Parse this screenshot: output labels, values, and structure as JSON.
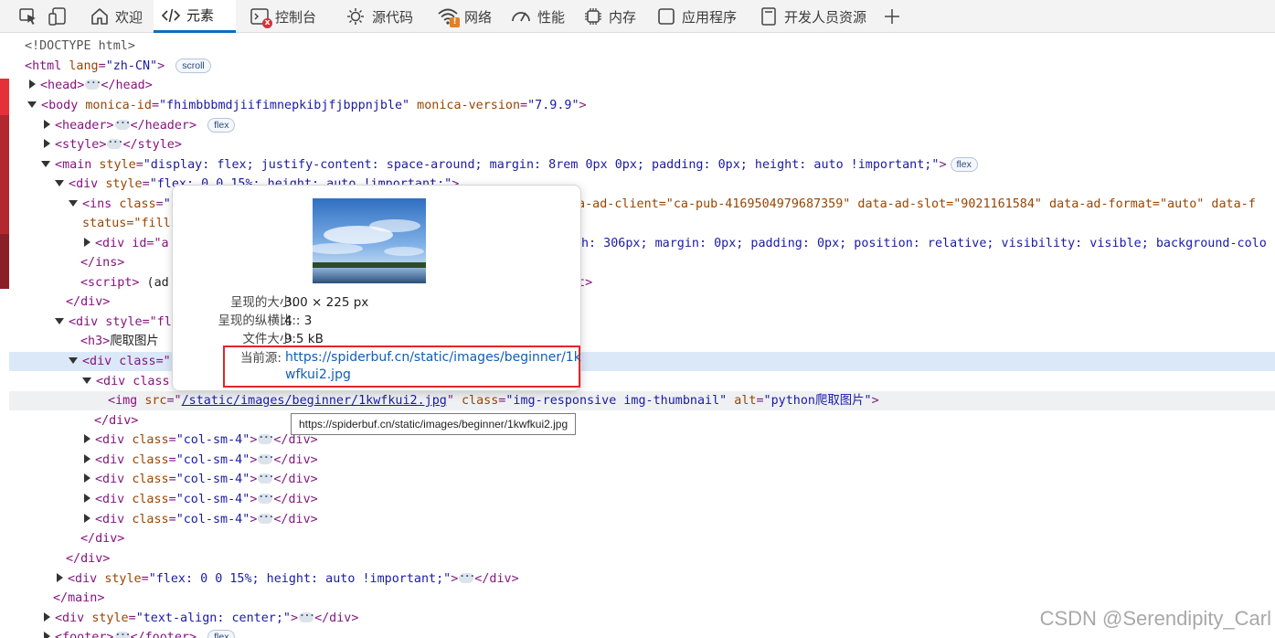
{
  "tabs": [
    {
      "label": "欢迎",
      "icon": "home-icon"
    },
    {
      "label": "元素",
      "icon": "code-brackets-icon",
      "active": true
    },
    {
      "label": "控制台",
      "icon": "console-icon"
    },
    {
      "label": "源代码",
      "icon": "bug-gear-icon"
    },
    {
      "label": "网络",
      "icon": "wifi-icon"
    },
    {
      "label": "性能",
      "icon": "speedometer-icon"
    },
    {
      "label": "内存",
      "icon": "chip-icon"
    },
    {
      "label": "应用程序",
      "icon": "app-window-icon"
    },
    {
      "label": "开发人员资源",
      "icon": "document-icon"
    }
  ],
  "toolbar": {
    "inspect_icon": "inspect-icon",
    "device_icon": "device-emulation-icon",
    "add_tab_icon": "plus-icon"
  },
  "badges": {
    "console": "x",
    "network": "!"
  },
  "tree": {
    "doctype": "<!DOCTYPE html>",
    "html_tag": "html",
    "html_attr": "lang",
    "html_val": "\"zh-CN\"",
    "scroll_pill": "scroll",
    "head_open": "<head>",
    "head_close": "</head>",
    "body_tag": "body",
    "body_attr1": "monica-id",
    "body_val1": "\"fhimbbbmdjiifimnepkibjfjbppnjble\"",
    "body_attr2": "monica-version",
    "body_val2": "\"7.9.9\"",
    "header_open": "<header>",
    "header_close": "</header>",
    "flex_pill": "flex",
    "style_open": "<style>",
    "style_close": "</style>",
    "main_tag": "main",
    "main_attr": "style",
    "main_val": "\"display: flex; justify-content: space-around; margin: 8rem 0px 0px; padding: 0px; height: auto !important;\"",
    "div1_tag": "div",
    "div1_attr": "style",
    "div1_val": "\"flex: 0 0 15%; height: auto !important;\"",
    "ins_tag": "ins",
    "ins_attr": "class",
    "ins_val": "\"",
    "ins_rest": "ta-ad-client=\"ca-pub-4169504979687359\" data-ad-slot=\"9021161584\" data-ad-format=\"auto\" data-f",
    "ins_status": "status=\"fill",
    "divid_open": "<div id=\"a",
    "divid_rest": "h: 306px; margin: 0px; padding: 0px; position: relative; visibility: visible; background-colo",
    "ins_close": "</ins>",
    "script_open": "<script>",
    "script_ad": " (ad",
    "script_rest": "pt>",
    "div_close": "</div>",
    "div2_open": "<div style=\"fl",
    "h3_open": "<h3>",
    "h3_text": "爬取图片",
    "div3_open": "<div class=\"",
    "div4_open": "<div class",
    "img_tag": "img",
    "img_src_attr": "src",
    "img_src": "/static/images/beginner/1kwfkui2.jpg",
    "img_class_attr": "class",
    "img_class": "\"img-responsive img-thumbnail\"",
    "img_alt_attr": "alt",
    "img_alt": "\"python爬取图片\"",
    "colsm": "\"col-sm-4\"",
    "main_close": "</main>",
    "div_last_val": "\"flex: 0 0 15%; height: auto !important;\"",
    "div_center_val": "\"text-align: center;\"",
    "footer_open": "<footer>",
    "footer_close": "</footer>"
  },
  "card": {
    "size_label": "呈现的大小:",
    "size_value": "300 × 225 px",
    "aspect_label": "呈现的纵横比:",
    "aspect_value": "4 : 3",
    "file_label": "文件大小:",
    "file_value": "9.5 kB",
    "source_label": "当前源:",
    "source_value": "https://spiderbuf.cn/static/images/beginner/1kwfkui2.jpg"
  },
  "tooltip": "https://spiderbuf.cn/static/images/beginner/1kwfkui2.jpg",
  "watermark": "CSDN @Serendipity_Carl",
  "colors": {
    "accent": "#0f6cbd",
    "highlight_box": "#e0262c"
  }
}
